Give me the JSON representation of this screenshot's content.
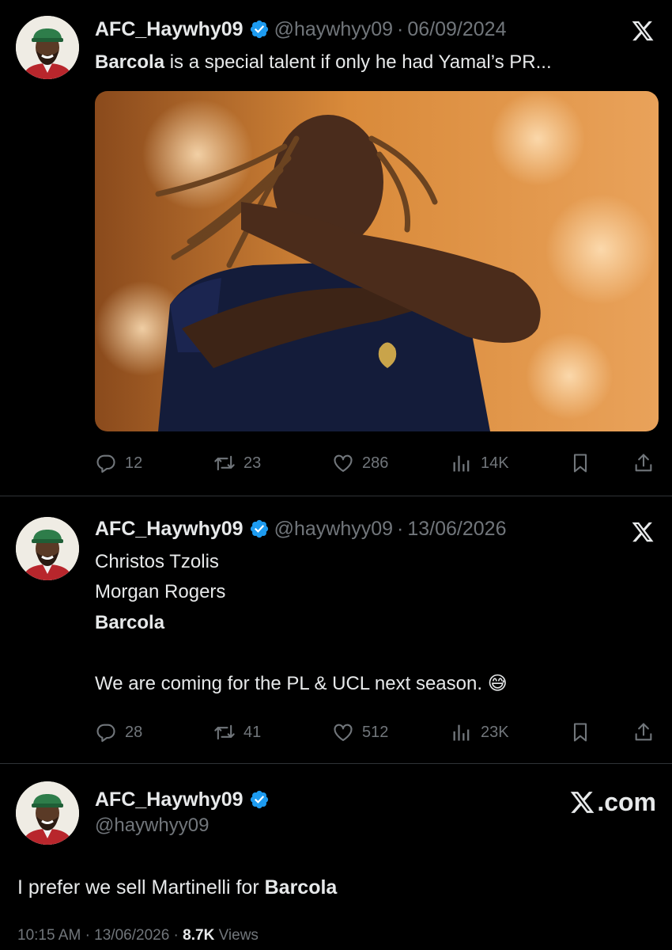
{
  "tweets": [
    {
      "name": "AFC_Haywhy09",
      "handle": "@haywhyy09",
      "separator": "·",
      "date": "06/09/2024",
      "text_bold": "Barcola",
      "text_rest": " is a special talent if only he had Yamal’s PR...",
      "actions": {
        "replies": "12",
        "retweets": "23",
        "likes": "286",
        "views": "14K"
      }
    },
    {
      "name": "AFC_Haywhy09",
      "handle": "@haywhyy09",
      "separator": "·",
      "date": "13/06/2026",
      "lines": [
        "Christos Tzolis",
        "Morgan Rogers",
        "Barcola",
        "We are coming for the PL & UCL next season. 😅"
      ],
      "actions": {
        "replies": "28",
        "retweets": "41",
        "likes": "512",
        "views": "23K"
      }
    },
    {
      "name": "AFC_Haywhy09",
      "handle": "@haywhyy09",
      "brand": ".com",
      "text_pre": "I prefer we sell Martinelli for ",
      "text_bold": "Barcola",
      "time": "10:15 AM",
      "separator": "·",
      "date": "13/06/2026",
      "views_count": "8.7K",
      "views_label": " Views"
    }
  ],
  "colors": {
    "background": "#000000",
    "text": "#e7e9ea",
    "muted": "#71767b",
    "verified": "#1d9bf0",
    "divider": "#2f3336"
  },
  "icons": [
    "reply-icon",
    "retweet-icon",
    "like-icon",
    "views-icon",
    "bookmark-icon",
    "share-icon",
    "x-logo-icon",
    "verified-badge-icon"
  ]
}
